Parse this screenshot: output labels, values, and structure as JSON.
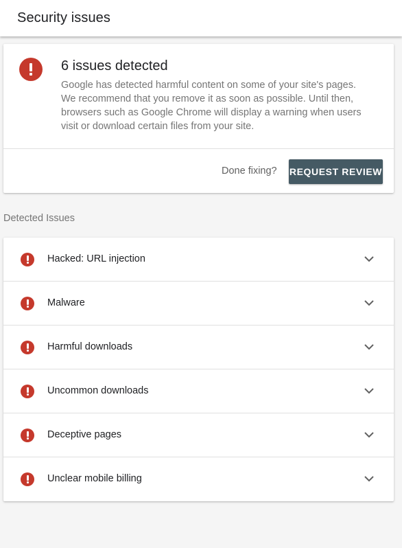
{
  "header": {
    "title": "Security issues"
  },
  "summary": {
    "heading": "6 issues detected",
    "body_lines": [
      "Google has detected harmful content on some of your site's pages.",
      "We recommend that you remove it as soon as possible. Until then,",
      "browsers such as Google Chrome will display a warning when users",
      "visit or download certain files from your site."
    ],
    "done_text": "Done fixing?",
    "review_button": "REQUEST REVIEW"
  },
  "detected": {
    "section_label": "Detected Issues",
    "issues": [
      {
        "label": "Hacked: URL injection"
      },
      {
        "label": "Malware"
      },
      {
        "label": "Harmful downloads"
      },
      {
        "label": "Uncommon downloads"
      },
      {
        "label": "Deceptive pages"
      },
      {
        "label": "Unclear mobile billing"
      }
    ]
  },
  "colors": {
    "alert": "#c5392c",
    "button_bg": "#455a64",
    "muted_text": "#757575"
  },
  "icons": {
    "alert": "error-circle-icon",
    "expand": "chevron-down-icon"
  }
}
